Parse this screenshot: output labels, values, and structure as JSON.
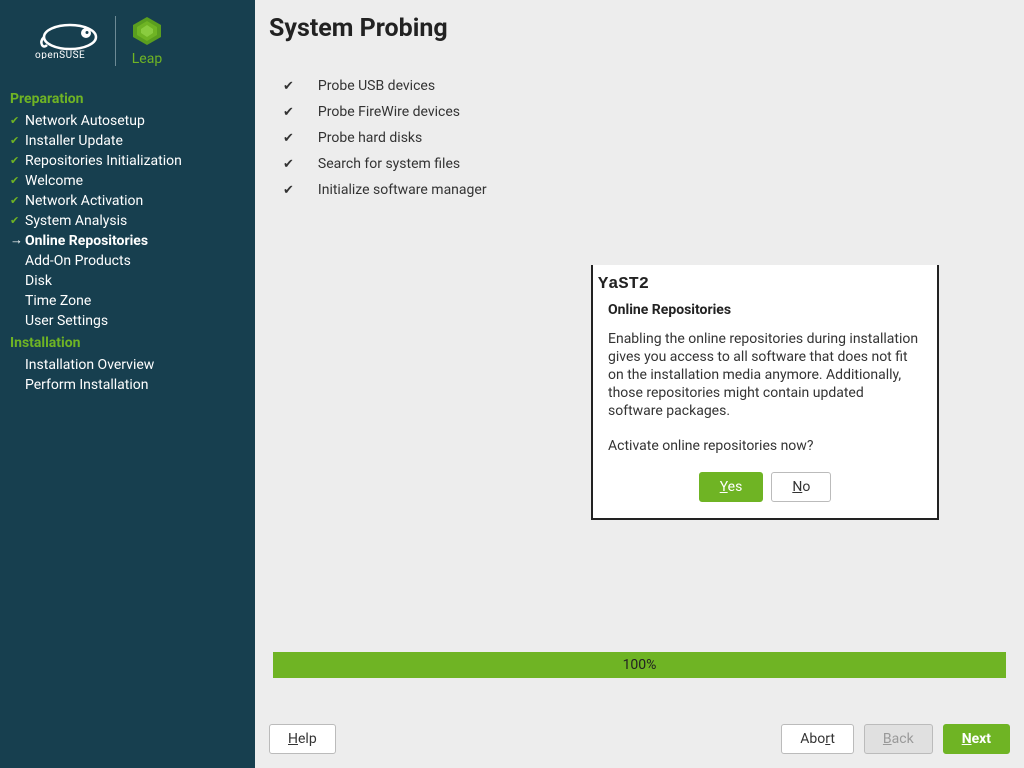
{
  "branding": {
    "distro": "openSUSE",
    "product": "Leap"
  },
  "sidebar": {
    "sections": [
      {
        "title": "Preparation",
        "items": [
          {
            "label": "Network Autosetup",
            "status": "done"
          },
          {
            "label": "Installer Update",
            "status": "done"
          },
          {
            "label": "Repositories Initialization",
            "status": "done"
          },
          {
            "label": "Welcome",
            "status": "done"
          },
          {
            "label": "Network Activation",
            "status": "done"
          },
          {
            "label": "System Analysis",
            "status": "done"
          },
          {
            "label": "Online Repositories",
            "status": "current"
          },
          {
            "label": "Add-On Products",
            "status": "pending"
          },
          {
            "label": "Disk",
            "status": "pending"
          },
          {
            "label": "Time Zone",
            "status": "pending"
          },
          {
            "label": "User Settings",
            "status": "pending"
          }
        ]
      },
      {
        "title": "Installation",
        "items": [
          {
            "label": "Installation Overview",
            "status": "pending"
          },
          {
            "label": "Perform Installation",
            "status": "pending"
          }
        ]
      }
    ]
  },
  "page": {
    "title": "System Probing",
    "probes": [
      "Probe USB devices",
      "Probe FireWire devices",
      "Probe hard disks",
      "Search for system files",
      "Initialize software manager"
    ]
  },
  "dialog": {
    "title": "YaST2",
    "heading": "Online Repositories",
    "text": "Enabling the online repositories during installation gives you access to all software that does not fit on the installation media anymore. Additionally, those repositories might contain updated software packages.",
    "question": "Activate online repositories now?",
    "buttons": {
      "yes_char": "Y",
      "yes_rest": "es",
      "no_char": "N",
      "no_rest": "o"
    }
  },
  "progress": {
    "percent": "100%"
  },
  "footer": {
    "help_char": "H",
    "help_rest": "elp",
    "abort_pre": "Abo",
    "abort_char": "r",
    "abort_post": "t",
    "back_char": "B",
    "back_rest": "ack",
    "next_char": "N",
    "next_rest": "ext"
  }
}
